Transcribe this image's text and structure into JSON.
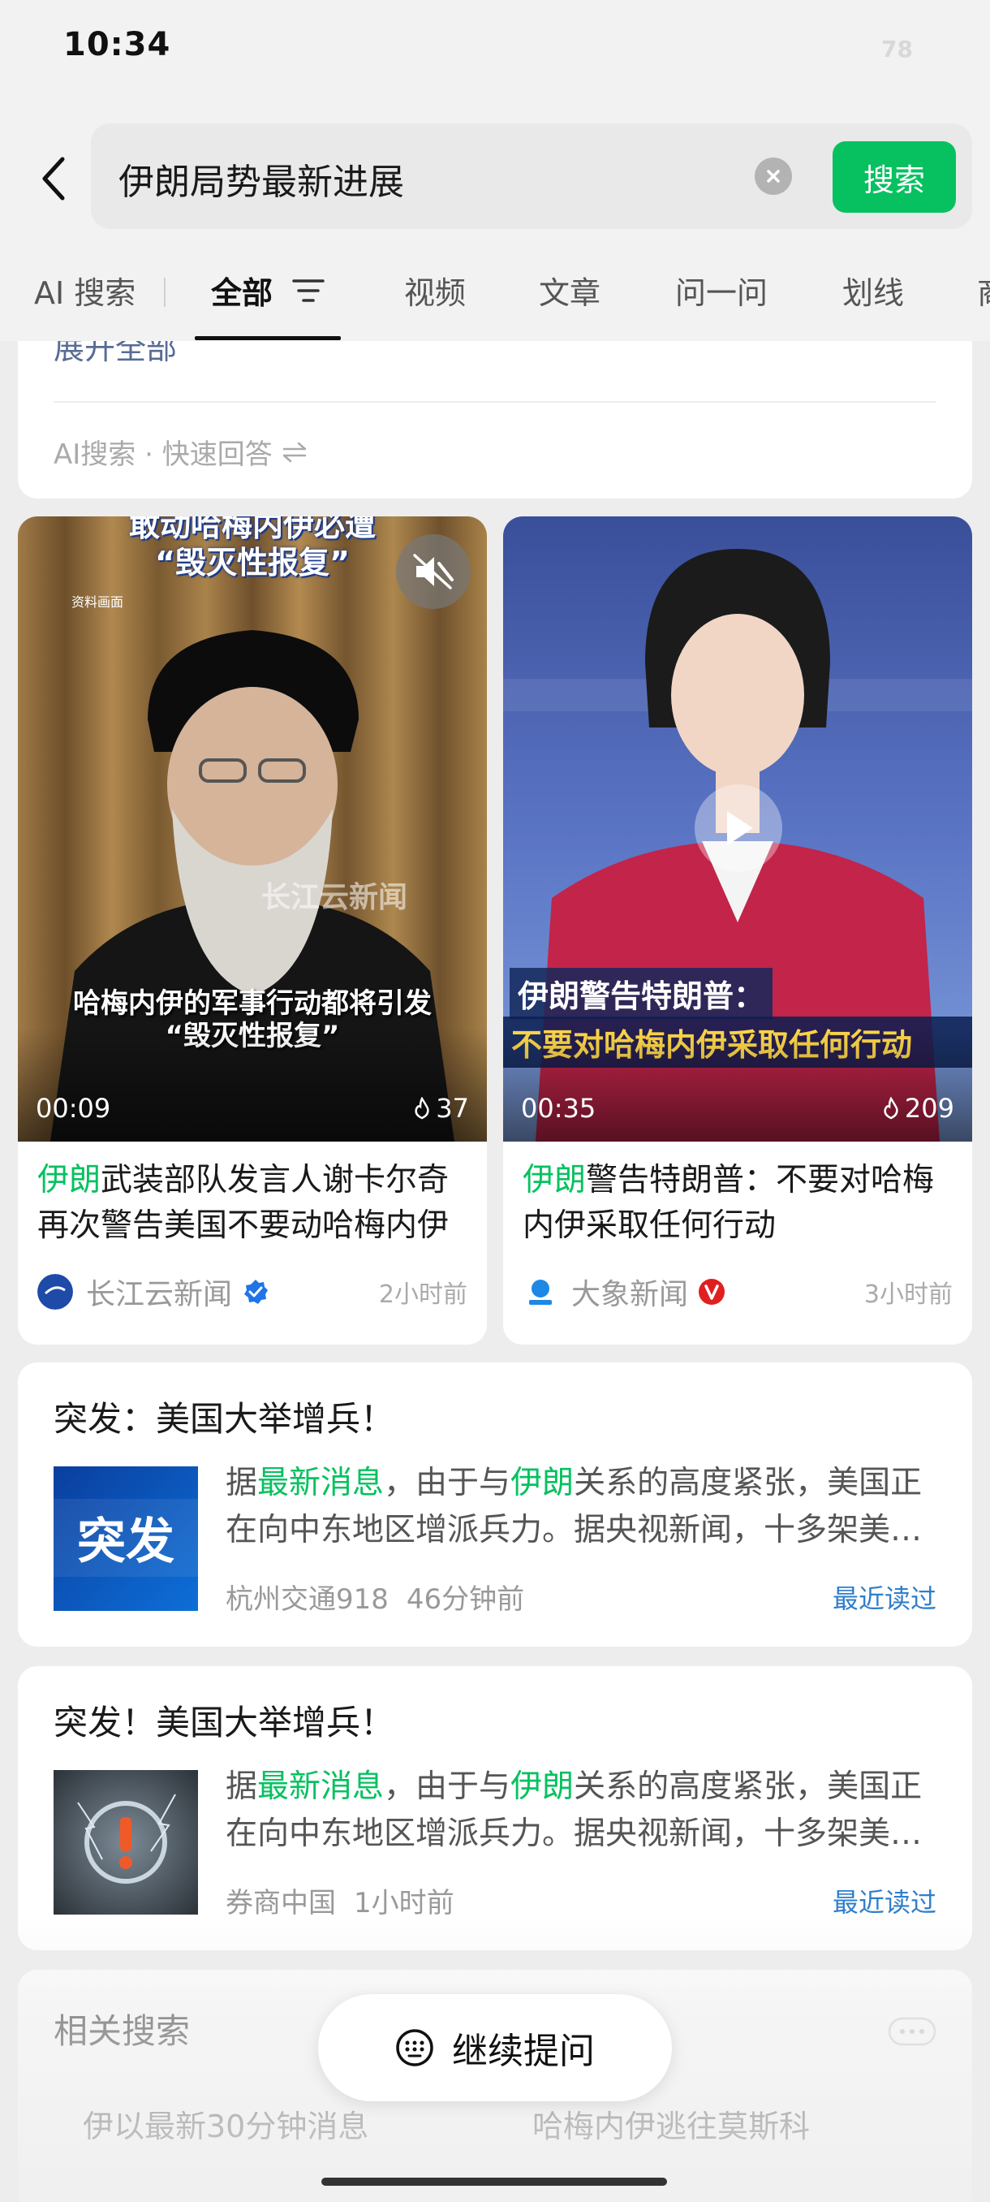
{
  "status_bar": {
    "time": "10:34",
    "battery": "78"
  },
  "search": {
    "query": "伊朗局势最新进展",
    "button_label": "搜索"
  },
  "tabs": [
    {
      "label": "AI 搜索"
    },
    {
      "label": "全部"
    },
    {
      "label": "视频"
    },
    {
      "label": "文章"
    },
    {
      "label": "问一问"
    },
    {
      "label": "划线"
    },
    {
      "label": "商"
    }
  ],
  "ai_card": {
    "expand_label": "展开全部",
    "footer": "AI搜索 · 快速回答"
  },
  "videos": [
    {
      "caption_top": "敢动哈梅内伊必遭\n“毁灭性报复”",
      "source_tag": "资料画面",
      "watermark": "长江云新闻",
      "caption_bottom": "哈梅内伊的军事行动都将引发\n“毁灭性报复”",
      "duration": "00:09",
      "views": "37",
      "title_highlight": "伊朗",
      "title_rest": "武装部队发言人谢卡尔奇再次警告美国不要动哈梅内伊",
      "source": "长江云新闻",
      "time": "2小时前",
      "avatar_label": "长江云"
    },
    {
      "banner_line1": "伊朗警告特朗普：",
      "banner_line2": "不要对哈梅内伊采取任何行动",
      "duration": "00:35",
      "views": "209",
      "title_highlight": "伊朗",
      "title_rest": "警告特朗普：不要对哈梅内伊采取任何行动",
      "source": "大象新闻",
      "time": "3小时前",
      "avatar_label": "大象新闻"
    }
  ],
  "articles": [
    {
      "title": "突发：美国大举增兵！",
      "thumb_text": "突发",
      "summary_pre": "据",
      "summary_hl1": "最新消息",
      "summary_mid": "，由于与",
      "summary_hl2": "伊朗",
      "summary_post": "关系的高度紧张，美国正在向中东地区增派兵力。据央视新闻，十多架美军战机已抵达",
      "source": "杭州交通918",
      "time": "46分钟前",
      "read_label": "最近读过"
    },
    {
      "title": "突发！美国大举增兵！",
      "summary_pre": "据",
      "summary_hl1": "最新消息",
      "summary_mid": "，由于与",
      "summary_hl2": "伊朗",
      "summary_post": "关系的高度紧张，美国正在向中东地区增派兵力。据央视新闻，十多架美军战机已抵达",
      "source": "券商中国",
      "time": "1小时前",
      "read_label": "最近读过"
    }
  ],
  "related": {
    "title": "相关搜索",
    "items": [
      "伊以最新30分钟消息",
      "哈梅内伊逃往莫斯科"
    ]
  },
  "continue_button": {
    "label": "继续提问"
  },
  "colors": {
    "accent_green": "#07c160",
    "link_blue": "#2f7ecb",
    "tag_blue": "#576b95"
  }
}
